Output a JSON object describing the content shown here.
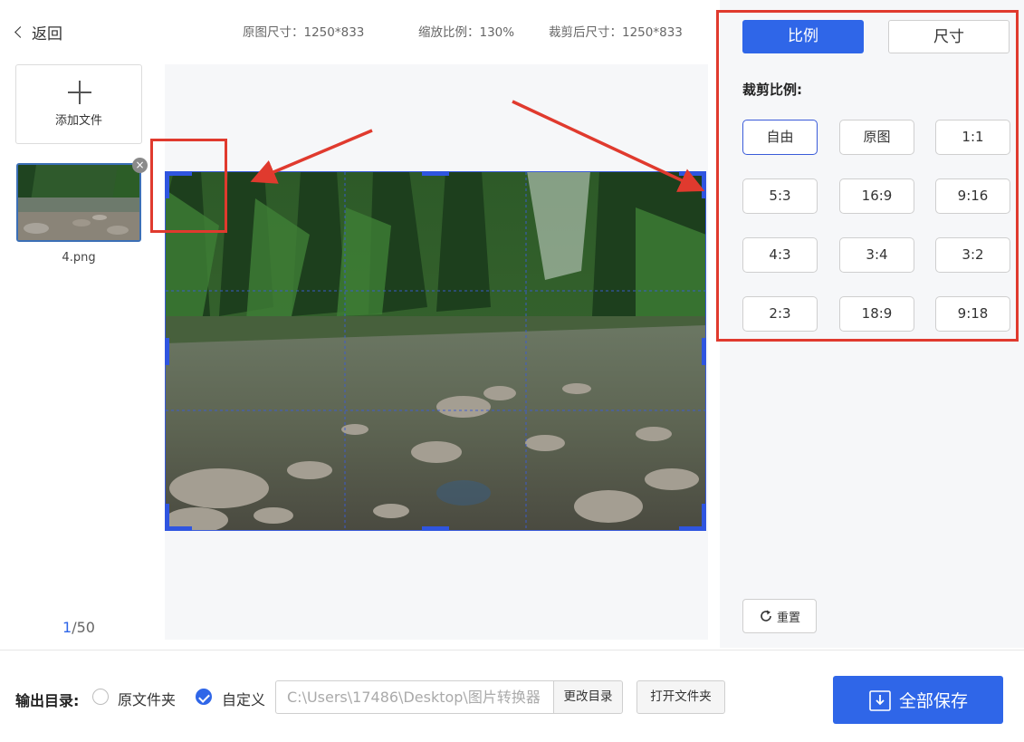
{
  "header": {
    "back_label": "返回",
    "original_size": "原图尺寸：1250*833",
    "zoom": "缩放比例：130%",
    "cropped_size": "裁剪后尺寸：1250*833"
  },
  "files": {
    "add_label": "添加文件",
    "items": [
      {
        "name": "4.png"
      }
    ],
    "page_current": "1",
    "page_total": "/50"
  },
  "settings": {
    "tabs": [
      {
        "label": "比例",
        "active": true
      },
      {
        "label": "尺寸",
        "active": false
      }
    ],
    "section_title": "裁剪比例:",
    "ratios": [
      "自由",
      "原图",
      "1:1",
      "5:3",
      "16:9",
      "9:16",
      "4:3",
      "3:4",
      "3:2",
      "2:3",
      "18:9",
      "9:18"
    ],
    "selected_ratio": "自由",
    "reset_label": "重置"
  },
  "output": {
    "label": "输出目录:",
    "option_original": "原文件夹",
    "option_custom": "自定义",
    "selected_option": "自定义",
    "path": "C:\\Users\\17486\\Desktop\\图片转换器",
    "change_dir_label": "更改目录",
    "open_folder_label": "打开文件夹",
    "save_all_label": "全部保存"
  },
  "colors": {
    "accent": "#2f66e8",
    "annotation": "#e03a2e",
    "crop_frame": "#3a5bd9"
  }
}
